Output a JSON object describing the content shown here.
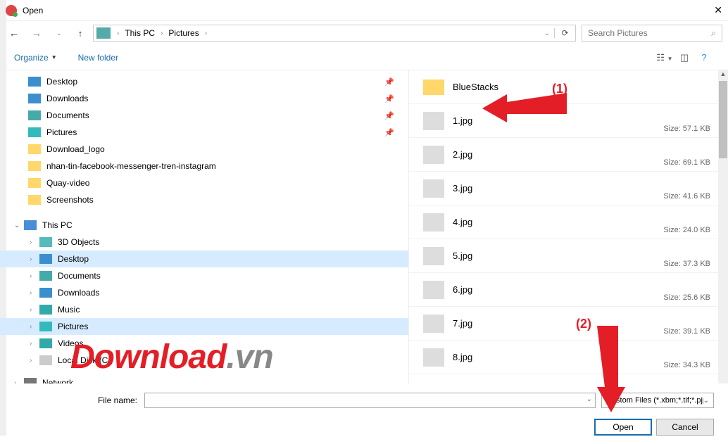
{
  "title": "Open",
  "breadcrumb": {
    "seg1": "This PC",
    "seg2": "Pictures"
  },
  "search": {
    "placeholder": "Search Pictures"
  },
  "toolbar": {
    "organize": "Organize",
    "newfolder": "New folder"
  },
  "tree": [
    {
      "label": "Desktop",
      "icon": "desktop",
      "pin": true
    },
    {
      "label": "Downloads",
      "icon": "download",
      "pin": true
    },
    {
      "label": "Documents",
      "icon": "docs",
      "pin": true
    },
    {
      "label": "Pictures",
      "icon": "pics",
      "pin": true
    },
    {
      "label": "Download_logo",
      "icon": "folder"
    },
    {
      "label": "nhan-tin-facebook-messenger-tren-instagram",
      "icon": "folder"
    },
    {
      "label": "Quay-video",
      "icon": "folder"
    },
    {
      "label": "Screenshots",
      "icon": "folder"
    }
  ],
  "thispc": {
    "label": "This PC",
    "children": [
      {
        "label": "3D Objects",
        "icon": "3d"
      },
      {
        "label": "Desktop",
        "icon": "desktop",
        "selected": true
      },
      {
        "label": "Documents",
        "icon": "docs"
      },
      {
        "label": "Downloads",
        "icon": "download"
      },
      {
        "label": "Music",
        "icon": "music"
      },
      {
        "label": "Pictures",
        "icon": "pics",
        "selected": true
      },
      {
        "label": "Videos",
        "icon": "video"
      },
      {
        "label": "Local Disk (C:)",
        "icon": "disk"
      }
    ]
  },
  "network": {
    "label": "Network"
  },
  "files": [
    {
      "name": "BlueStacks",
      "folder": true
    },
    {
      "name": "1.jpg",
      "size": "Size: 57.1 KB"
    },
    {
      "name": "2.jpg",
      "size": "Size: 69.1 KB"
    },
    {
      "name": "3.jpg",
      "size": "Size: 41.6 KB"
    },
    {
      "name": "4.jpg",
      "size": "Size: 24.0 KB"
    },
    {
      "name": "5.jpg",
      "size": "Size: 37.3 KB"
    },
    {
      "name": "6.jpg",
      "size": "Size: 25.6 KB"
    },
    {
      "name": "7.jpg",
      "size": "Size: 39.1 KB"
    },
    {
      "name": "8.jpg",
      "size": "Size: 34.3 KB"
    }
  ],
  "footer": {
    "filenameLabel": "File name:",
    "filter": "Custom Files (*.xbm;*.tif;*.pjp;*",
    "open": "Open",
    "cancel": "Cancel"
  },
  "annotations": {
    "a1": "(1)",
    "a2": "(2)"
  },
  "watermark": {
    "main": "Download",
    "suffix": ".vn"
  }
}
